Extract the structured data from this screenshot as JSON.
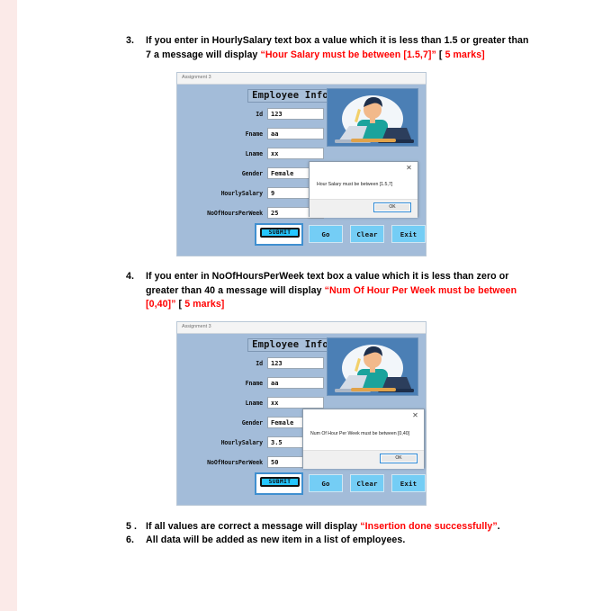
{
  "document": {
    "items": [
      {
        "number": "3.",
        "segments": [
          {
            "text": "If you enter in HourlySalary text box a value which it is less than 1.5 or greater than 7 a message will display ",
            "color": "black"
          },
          {
            "text": "“Hour Salary must be between [1.5,7]”",
            "color": "red"
          },
          {
            "text": " [ ",
            "color": "black"
          },
          {
            "text": "5 marks]",
            "color": "red"
          }
        ]
      },
      {
        "number": "4.",
        "segments": [
          {
            "text": "If you enter in NoOfHoursPerWeek text box a value which it is less than zero or greater than 40 a message will display ",
            "color": "black"
          },
          {
            "text": "“Num Of Hour Per Week must be between [0,40]”",
            "color": "red"
          },
          {
            "text": " [ ",
            "color": "black"
          },
          {
            "text": "5 marks]",
            "color": "red"
          }
        ]
      },
      {
        "number": "5 .",
        "segments": [
          {
            "text": "If all values are correct a message will display  ",
            "color": "black"
          },
          {
            "text": "“Insertion done successfully”",
            "color": "red"
          },
          {
            "text": ".",
            "color": "black"
          }
        ]
      },
      {
        "number": "6.",
        "segments": [
          {
            "text": "All data will be added as new item in a list of employees.",
            "color": "black"
          }
        ]
      }
    ]
  },
  "screenshot_one": {
    "window_title": "Assignment 3",
    "header_label": "Employee Info",
    "fields": [
      {
        "label": "Id",
        "value": "123",
        "type": "text"
      },
      {
        "label": "Fname",
        "value": "aa",
        "type": "text"
      },
      {
        "label": "Lname",
        "value": "xx",
        "type": "text"
      },
      {
        "label": "Gender",
        "value": "Female",
        "type": "select"
      },
      {
        "label": "HourlySalary",
        "value": "9",
        "type": "text"
      },
      {
        "label": "NoOfHoursPerWeek",
        "value": "25",
        "type": "text"
      }
    ],
    "submit_label": "SUBMIT",
    "buttons": [
      {
        "label": "Go"
      },
      {
        "label": "Clear"
      },
      {
        "label": "Exit"
      }
    ],
    "dialog": {
      "message": "Hour Salary must be between [1.5,7]",
      "ok_label": "OK",
      "close_label": "✕"
    }
  },
  "screenshot_two": {
    "window_title": "Assignment 3",
    "header_label": "Employee Info",
    "fields": [
      {
        "label": "Id",
        "value": "123",
        "type": "text"
      },
      {
        "label": "Fname",
        "value": "aa",
        "type": "text"
      },
      {
        "label": "Lname",
        "value": "xx",
        "type": "text"
      },
      {
        "label": "Gender",
        "value": "Female",
        "type": "select"
      },
      {
        "label": "HourlySalary",
        "value": "3.5",
        "type": "text"
      },
      {
        "label": "NoOfHoursPerWeek",
        "value": "50",
        "type": "text"
      }
    ],
    "submit_label": "SUBMIT",
    "buttons": [
      {
        "label": "Go"
      },
      {
        "label": "Clear"
      },
      {
        "label": "Exit"
      }
    ],
    "dialog": {
      "message": "Num Of Hour Per Week must be between [0,40]",
      "ok_label": "OK",
      "close_label": "✕"
    }
  },
  "colors": {
    "form_background": "#a3bcd9",
    "button_blue": "#74cdf5",
    "accent_red": "#ff0000",
    "illustration_bg": "#4b7fb5",
    "submit_cyan": "#24c6ff"
  }
}
